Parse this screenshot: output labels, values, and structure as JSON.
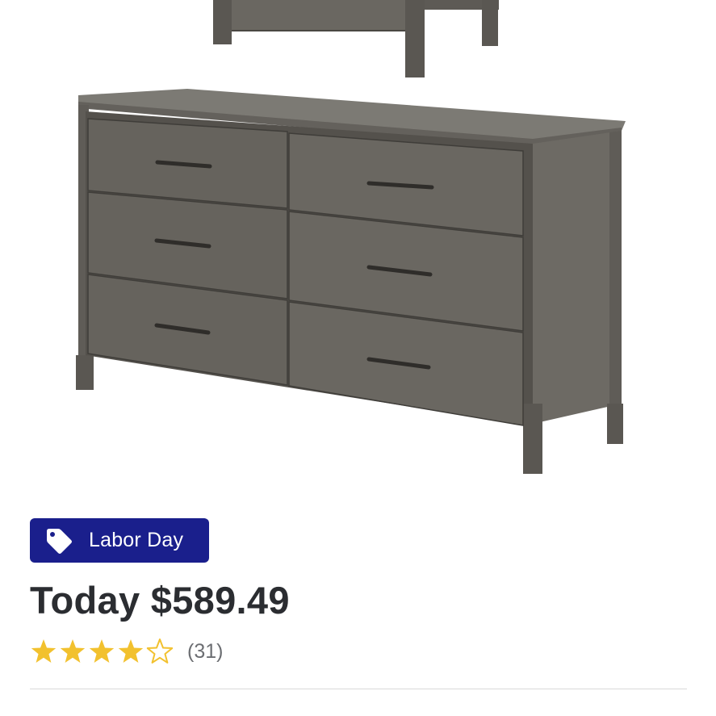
{
  "product": {
    "image_alt": "Gray wood six-drawer dresser",
    "badge": {
      "label": "Labor Day",
      "icon": "tag-icon",
      "color": "#1a1f8c"
    },
    "price": {
      "prefix": "Today",
      "value": "$589.49",
      "text": "Today $589.49"
    },
    "rating": {
      "value": 4,
      "max": 5,
      "count_text": "(31)",
      "star_color": "#f2c12e",
      "empty_star_color": "#f2c12e"
    }
  }
}
